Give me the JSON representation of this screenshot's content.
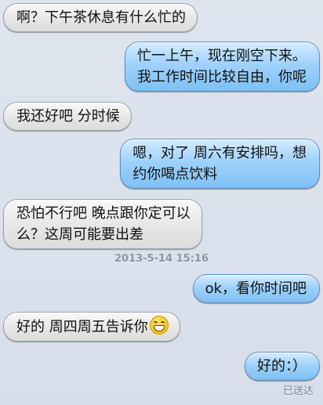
{
  "messages": [
    {
      "direction": "incoming",
      "lines": [
        "啊？下午茶休息有什么忙的"
      ]
    },
    {
      "direction": "outgoing",
      "lines": [
        "忙一上午，现在刚空下来。",
        "我工作时间比较自由，你呢"
      ]
    },
    {
      "direction": "incoming",
      "lines": [
        "我还好吧 分时候"
      ]
    },
    {
      "direction": "outgoing",
      "lines": [
        "嗯，对了 周六有安排吗，想",
        "约你喝点饮料"
      ]
    },
    {
      "direction": "incoming",
      "lines": [
        "恐怕不行吧 晚点跟你定可以",
        "么？这周可能要出差"
      ]
    },
    {
      "direction": "outgoing",
      "lines": [
        "ok，看你时间吧"
      ]
    },
    {
      "direction": "incoming",
      "lines": [
        "好的 周四周五告诉你"
      ],
      "emoji": "grinning-face-icon"
    },
    {
      "direction": "outgoing",
      "lines": [
        "好的：）"
      ]
    }
  ],
  "timestamp": "2013-5-14 15:16",
  "status": "已送达",
  "colors": {
    "background": "#dbe2ed",
    "incoming_bubble": "#e6e6e6",
    "outgoing_bubble": "#9fd2fb"
  }
}
